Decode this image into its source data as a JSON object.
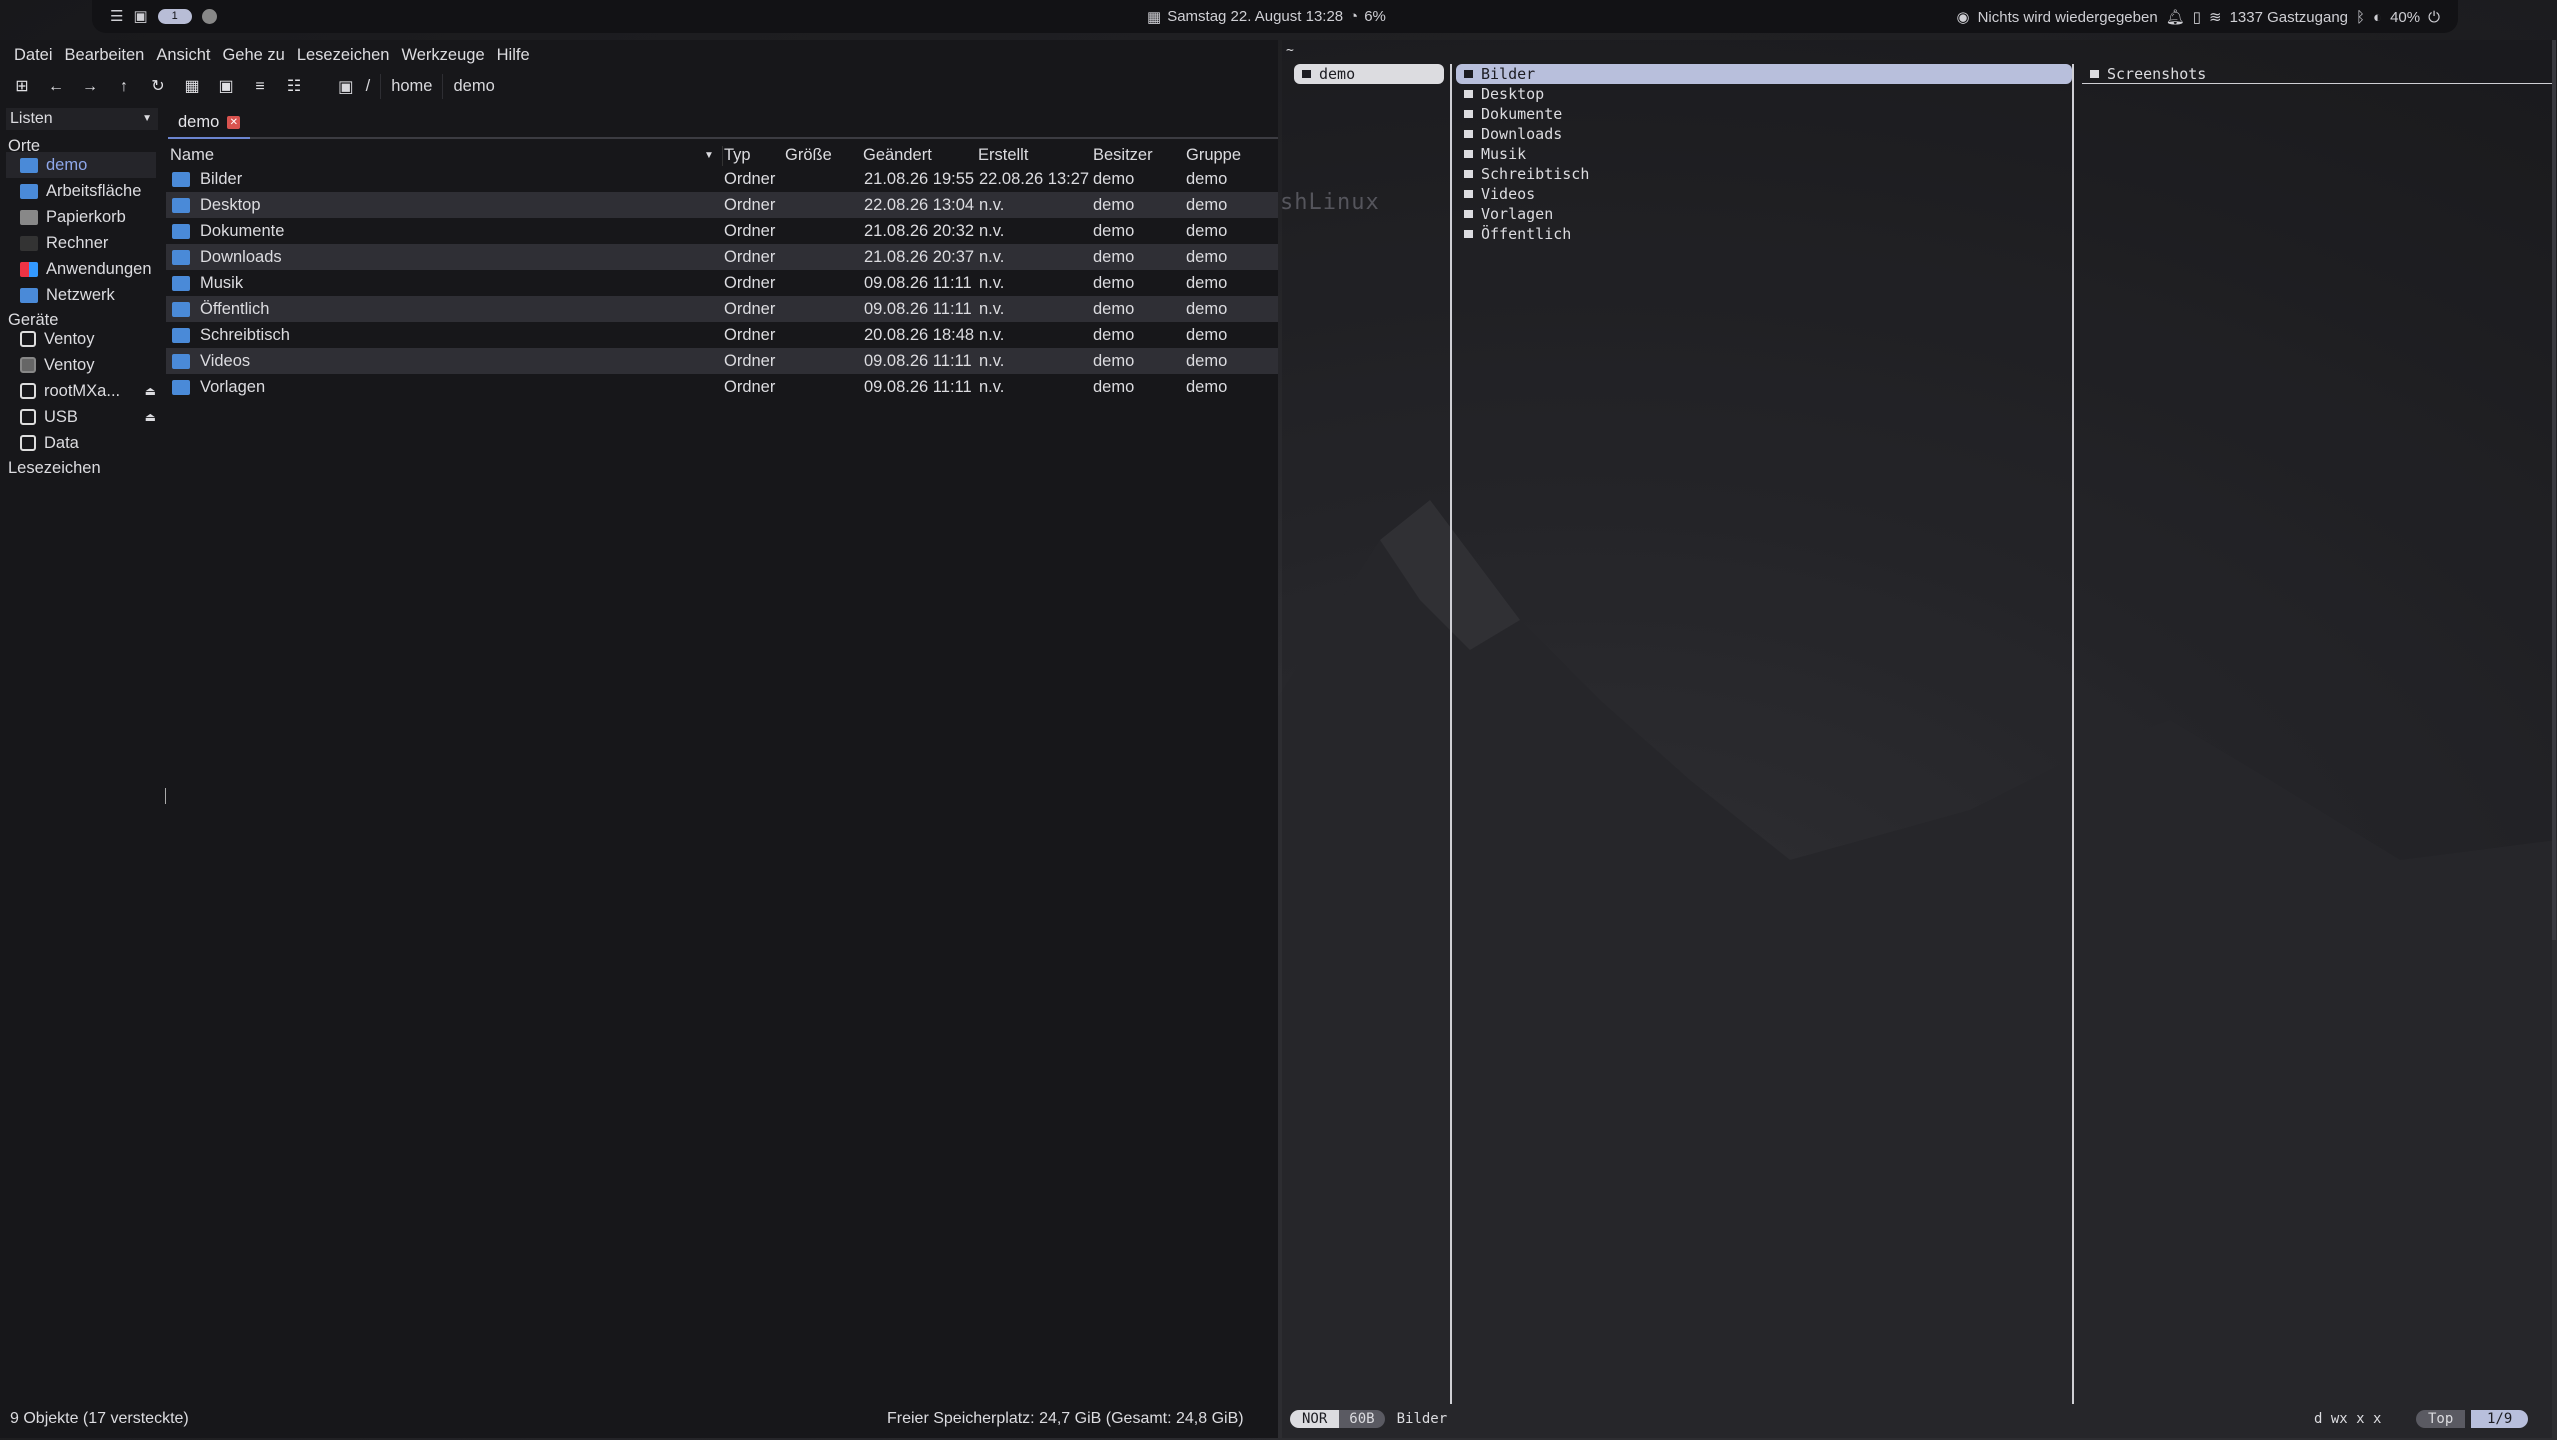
{
  "topbar": {
    "workspace": "1",
    "datetime": "Samstag 22. August  13:28",
    "cpu": "6%",
    "media": "Nichts wird wiedergegeben",
    "wifi": "1337 Gastzugang",
    "battery": "40%"
  },
  "filemanager": {
    "menu": [
      "Datei",
      "Bearbeiten",
      "Ansicht",
      "Gehe zu",
      "Lesezeichen",
      "Werkzeuge",
      "Hilfe"
    ],
    "breadcrumb": [
      "/",
      "home",
      "demo"
    ],
    "view_mode": "Listen",
    "sidebar": {
      "places_title": "Orte",
      "places": [
        {
          "label": "demo",
          "icon": "home-folder-icon"
        },
        {
          "label": "Arbeitsfläche",
          "icon": "desktop-folder-icon"
        },
        {
          "label": "Papierkorb",
          "icon": "trash-icon"
        },
        {
          "label": "Rechner",
          "icon": "computer-icon"
        },
        {
          "label": "Anwendungen",
          "icon": "applications-icon"
        },
        {
          "label": "Netzwerk",
          "icon": "network-icon"
        }
      ],
      "devices_title": "Geräte",
      "devices": [
        {
          "label": "Ventoy",
          "icon": "drive-icon"
        },
        {
          "label": "Ventoy",
          "icon": "drive-icon"
        },
        {
          "label": "rootMXa...",
          "icon": "drive-icon"
        },
        {
          "label": "USB",
          "icon": "drive-icon"
        },
        {
          "label": "Data",
          "icon": "drive-icon"
        }
      ],
      "bookmarks_title": "Lesezeichen"
    },
    "tab": "demo",
    "columns": [
      "Name",
      "Typ",
      "Größe",
      "Geändert",
      "Erstellt",
      "Besitzer",
      "Gruppe"
    ],
    "rows": [
      {
        "name": "Bilder",
        "type": "Ordner",
        "size": "",
        "modified": "21.08.26 19:55",
        "created": "22.08.26 13:27",
        "owner": "demo",
        "group": "demo"
      },
      {
        "name": "Desktop",
        "type": "Ordner",
        "size": "",
        "modified": "22.08.26 13:04",
        "created": "n.v.",
        "owner": "demo",
        "group": "demo"
      },
      {
        "name": "Dokumente",
        "type": "Ordner",
        "size": "",
        "modified": "21.08.26 20:32",
        "created": "n.v.",
        "owner": "demo",
        "group": "demo"
      },
      {
        "name": "Downloads",
        "type": "Ordner",
        "size": "",
        "modified": "21.08.26 20:37",
        "created": "n.v.",
        "owner": "demo",
        "group": "demo"
      },
      {
        "name": "Musik",
        "type": "Ordner",
        "size": "",
        "modified": "09.08.26 11:11",
        "created": "n.v.",
        "owner": "demo",
        "group": "demo"
      },
      {
        "name": "Öffentlich",
        "type": "Ordner",
        "size": "",
        "modified": "09.08.26 11:11",
        "created": "n.v.",
        "owner": "demo",
        "group": "demo"
      },
      {
        "name": "Schreibtisch",
        "type": "Ordner",
        "size": "",
        "modified": "20.08.26 18:48",
        "created": "n.v.",
        "owner": "demo",
        "group": "demo"
      },
      {
        "name": "Videos",
        "type": "Ordner",
        "size": "",
        "modified": "09.08.26 11:11",
        "created": "n.v.",
        "owner": "demo",
        "group": "demo"
      },
      {
        "name": "Vorlagen",
        "type": "Ordner",
        "size": "",
        "modified": "09.08.26 11:11",
        "created": "n.v.",
        "owner": "demo",
        "group": "demo"
      }
    ],
    "status_left": "9 Objekte (17 versteckte)",
    "status_right": "Freier Speicherplatz: 24,7 GiB (Gesamt: 24,8 GiB)"
  },
  "terminal": {
    "prompt": "~",
    "logo_text": "shLinux",
    "parent": [
      "demo"
    ],
    "current": [
      "Bilder",
      "Desktop",
      "Dokumente",
      "Downloads",
      "Musik",
      "Schreibtisch",
      "Videos",
      "Vorlagen",
      "Öffentlich"
    ],
    "preview": [
      "Screenshots"
    ],
    "mode": "NOR",
    "size": "60B",
    "selected": "Bilder",
    "perms": "d wx  x  x",
    "position": "Top",
    "count": "1/9"
  }
}
